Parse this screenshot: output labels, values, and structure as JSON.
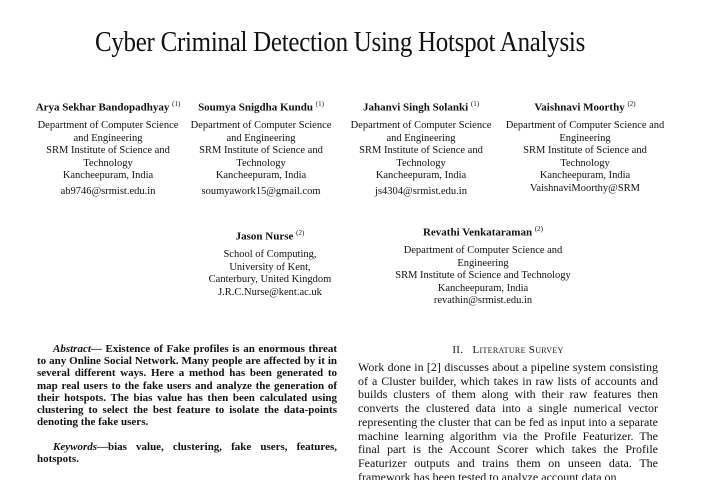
{
  "paper": {
    "title": "Cyber Criminal Detection Using Hotspot Analysis",
    "authors": [
      {
        "name": "Arya Sekhar Bandopadhyay",
        "sup": "(1)",
        "lines": [
          "Department of Computer Science",
          "and Engineering",
          "SRM Institute of Science and",
          "Technology",
          "Kancheepuram, India"
        ],
        "email": "ab9746@srmist.edu.in"
      },
      {
        "name": "Soumya Snigdha Kundu",
        "sup": "(1)",
        "lines": [
          "Department of Computer Science",
          "and Engineering",
          "SRM Institute of Science and",
          "Technology",
          "Kancheepuram, India"
        ],
        "email": "soumyawork15@gmail.com"
      },
      {
        "name": "Jahanvi Singh Solanki",
        "sup": "(1)",
        "lines": [
          "Department of Computer Science",
          "and Engineering",
          "SRM Institute of Science and",
          "Technology",
          "Kancheepuram, India"
        ],
        "email": "js4304@srmist.edu.in"
      },
      {
        "name": "Vaishnavi Moorthy",
        "sup": "(2)",
        "lines": [
          "Department of Computer Science and",
          "Engineering",
          "SRM Institute of Science and",
          "Technology",
          "Kancheepuram, India"
        ],
        "email": "VaishnaviMoorthy@SRM"
      },
      {
        "name": "Jason Nurse",
        "sup": "(2)",
        "lines": [
          "School of Computing,",
          "University of Kent,",
          "Canterbury, United Kingdom"
        ],
        "email": "J.R.C.Nurse@kent.ac.uk"
      },
      {
        "name": "Revathi Venkataraman",
        "sup": "(2)",
        "lines": [
          "Department of Computer Science and Engineering",
          "SRM Institute of Science and Technology",
          "Kancheepuram, India"
        ],
        "email": "revathin@srmist.edu.in"
      }
    ],
    "abstract": {
      "lead": "Abstract",
      "dash": "— ",
      "text": "Existence of Fake profiles is an enormous threat to any Online Social Network. Many people are affected by it in several different ways. Here a method has been generated to map real users to the fake users and analyze the generation of their hotspots. The bias value has then been calculated using clustering to select the best feature to isolate the data-points denoting the fake users."
    },
    "keywords": {
      "lead": "Keywords",
      "text": "—bias value, clustering, fake users, features, hotspots."
    },
    "section": {
      "numeral": "II.",
      "title": "Literature Survey"
    },
    "body": "Work done in [2] discusses about a pipeline system consisting of a Cluster builder, which takes in raw lists of accounts and builds clusters of them along with their raw features then converts the clustered data into a single numerical vector representing the cluster that can be fed as input into a separate machine learning algorithm via the Profile Featurizer. The final part is the Account Scorer which takes the Profile Featurizer outputs and trains them on unseen data. The framework has been tested to analyze account data on"
  }
}
